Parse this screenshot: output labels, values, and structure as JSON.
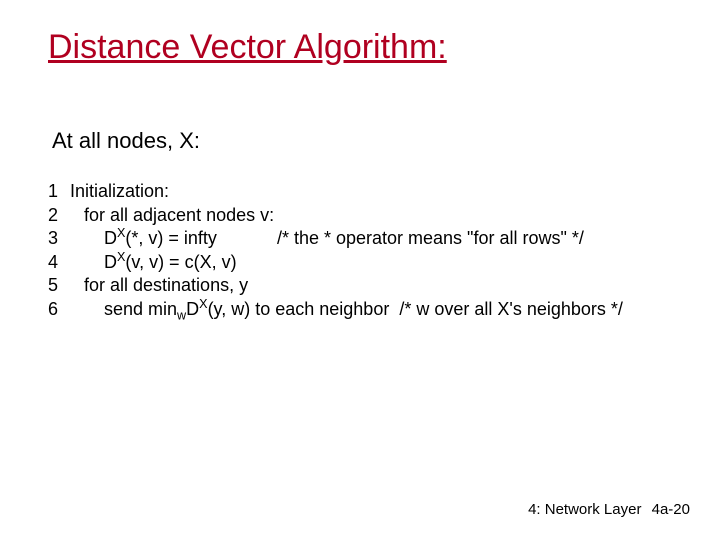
{
  "title": "Distance Vector Algorithm:",
  "subtitle": "At all nodes, X:",
  "code": {
    "l1": {
      "n": "1",
      "pre": "Initialization:"
    },
    "l2": {
      "n": "2",
      "pre": "for all adjacent nodes v:"
    },
    "l3": {
      "n": "3",
      "d": "D",
      "sup": "X",
      "args": "(*, v) = infty",
      "comment": "/* the * operator means \"for all rows\" */"
    },
    "l4": {
      "n": "4",
      "d": "D",
      "sup": "X",
      "args": "(v, v) = c(X, v)"
    },
    "l5": {
      "n": "5",
      "pre": "for all destinations, y"
    },
    "l6": {
      "n": "6",
      "pre": "send min",
      "sub": "w",
      "d": "D",
      "sup": "X",
      "args": "(y, w) to each neighbor",
      "comment": "/* w over all X's neighbors */"
    }
  },
  "footer": {
    "chapter": "4: Network Layer",
    "page": "4a-20"
  }
}
